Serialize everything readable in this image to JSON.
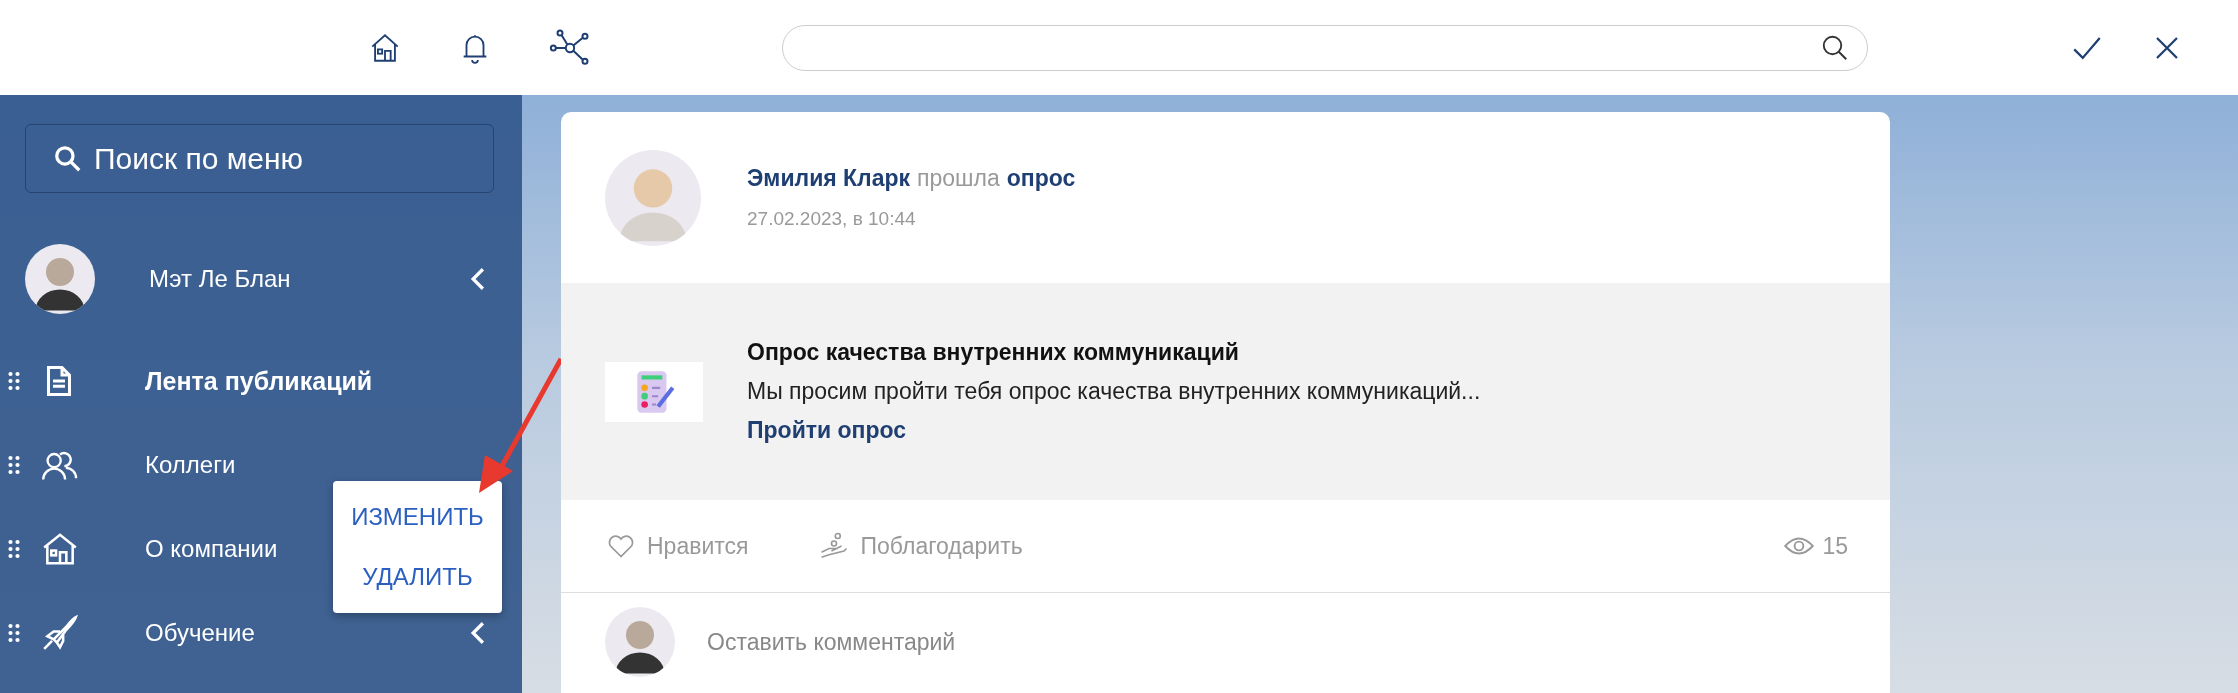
{
  "sidebar": {
    "search": {
      "placeholder": "Поиск по меню"
    },
    "profile": {
      "name": "Мэт Ле Блан",
      "expandable": true
    },
    "items": [
      {
        "label": "Лента публикаций",
        "kind": "document",
        "selected": true,
        "expandable": false
      },
      {
        "label": "Коллеги",
        "kind": "people",
        "selected": false,
        "expandable": false
      },
      {
        "label": "О компании",
        "kind": "house",
        "selected": false,
        "expandable": false
      },
      {
        "label": "Обучение",
        "kind": "rocket",
        "selected": false,
        "expandable": true
      }
    ]
  },
  "context_menu": {
    "items": [
      "ИЗМЕНИТЬ",
      "УДАЛИТЬ"
    ]
  },
  "post": {
    "author": "Эмилия Кларк",
    "action": "прошла",
    "object": "опрос",
    "date": "27.02.2023, в 10:44",
    "survey": {
      "title": "Опрос качества внутренних коммуникаций",
      "description": "Мы просим пройти тебя опрос качества внутренних коммуникаций...",
      "link": "Пройти опрос"
    },
    "actions": [
      {
        "kind": "like",
        "label": "Нравится"
      },
      {
        "kind": "thank",
        "label": "Поблагодарить"
      }
    ],
    "views": "15",
    "comment": {
      "placeholder": "Оставить комментарий"
    }
  }
}
